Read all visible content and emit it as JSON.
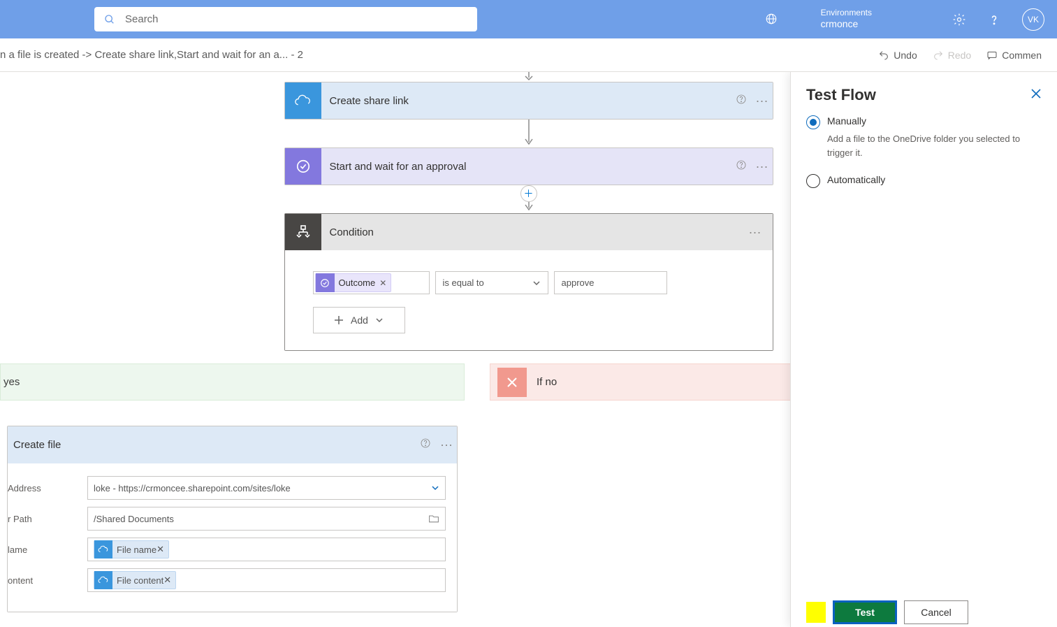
{
  "header": {
    "search_placeholder": "Search",
    "env_label": "Environments",
    "env_name": "crmonce",
    "avatar": "VK"
  },
  "toolbar": {
    "breadcrumb": "n a file is created -> Create share link,Start and wait for an a... - 2",
    "undo": "Undo",
    "redo": "Redo",
    "comments": "Commen"
  },
  "cards": {
    "share": {
      "title": "Create share link"
    },
    "approval": {
      "title": "Start and wait for an approval"
    },
    "condition": {
      "title": "Condition",
      "token": "Outcome",
      "operator": "is equal to",
      "value": "approve",
      "add": "Add"
    },
    "yes_label": "yes",
    "no_label": "If no",
    "add_action": "Add",
    "createfile": {
      "title": "Create file",
      "rows": {
        "site_label": "Address",
        "site_value": "loke - https://crmoncee.sharepoint.com/sites/loke",
        "folder_label": "r Path",
        "folder_value": "/Shared Documents",
        "name_label": "lame",
        "name_token": "File name",
        "content_label": "ontent",
        "content_token": "File content"
      }
    }
  },
  "panel": {
    "title": "Test Flow",
    "manually_label": "Manually",
    "manually_desc": "Add a file to the OneDrive folder you selected to trigger it.",
    "auto_label": "Automatically",
    "test_btn": "Test",
    "cancel_btn": "Cancel"
  }
}
